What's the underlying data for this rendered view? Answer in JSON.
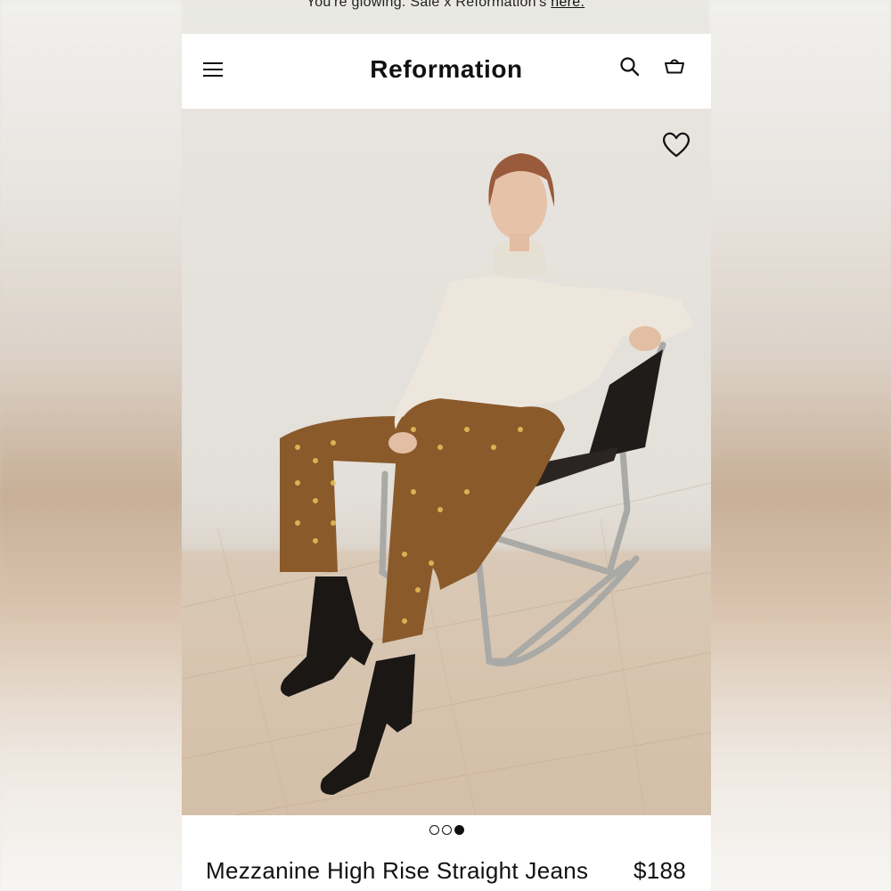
{
  "promo": {
    "text": "You're glowing. Sale x Reformation's ",
    "link": "here."
  },
  "header": {
    "brand": "Reformation",
    "icons": {
      "menu": "hamburger-menu-icon",
      "search": "search-icon",
      "cart": "shopping-basket-icon"
    }
  },
  "hero": {
    "favorite_icon": "heart-outline-icon"
  },
  "carousel": {
    "count": 3,
    "active_index": 2
  },
  "product": {
    "name": "Mezzanine High Rise Straight Jeans",
    "price": "$188"
  },
  "colors": {
    "page_bg": "#ffffff",
    "text": "#111111",
    "wall": "#e4e0da",
    "floor": "#d4bfa8",
    "sweater": "#ece6dc",
    "pants": "#8a5a2b",
    "boots": "#1a1715"
  }
}
